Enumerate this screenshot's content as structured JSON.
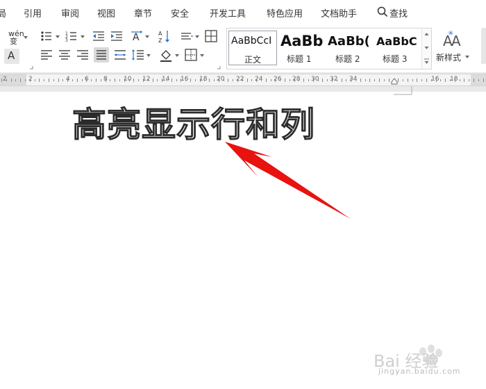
{
  "menu": {
    "items": [
      "局",
      "引用",
      "审阅",
      "视图",
      "章节",
      "安全",
      "开发工具",
      "特色应用",
      "文档助手"
    ],
    "search_label": "查找"
  },
  "ribbon": {
    "phonetic_glyph": "wén",
    "char_border_glyph": "A",
    "styles": [
      {
        "sample": "AaBbCcI",
        "name": "正文"
      },
      {
        "sample": "AaBb",
        "name": "标题 1"
      },
      {
        "sample": "AaBb(",
        "name": "标题 2"
      },
      {
        "sample": "AaBbC",
        "name": "标题 3"
      }
    ],
    "new_style_label": "新样式"
  },
  "ruler": {
    "numbers": [
      "2",
      "2",
      "4",
      "6",
      "8",
      "10",
      "12",
      "14",
      "16",
      "18",
      "20",
      "22",
      "24",
      "26",
      "28",
      "30",
      "32",
      "34",
      "16",
      "18"
    ]
  },
  "document": {
    "heading": "高亮显示行和列"
  },
  "watermark": {
    "text": "Bai 经验",
    "sub": "jingyan.baidu.com"
  },
  "colors": {
    "arrow": "#e8120f",
    "ribbon_bg": "#ffffff",
    "ruler_bg": "#f4f4f4"
  }
}
